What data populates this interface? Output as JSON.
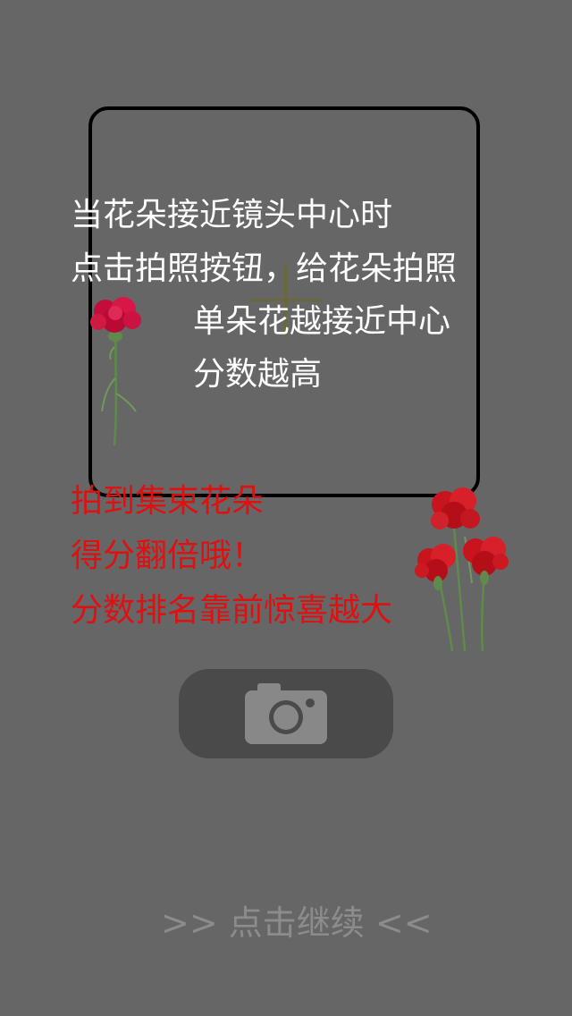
{
  "instructions": {
    "line1": "当花朵接近镜头中心时",
    "line2": "点击拍照按钮，给花朵拍照",
    "line3": "单朵花越接近中心",
    "line4": "分数越高"
  },
  "bonus": {
    "line1": "拍到集束花朵",
    "line2": "得分翻倍哦！",
    "line3": "分数排名靠前惊喜越大"
  },
  "continue": {
    "left_arrows": ">>",
    "label": "点击继续",
    "right_arrows": "<<"
  },
  "colors": {
    "background": "#666666",
    "instruction_text": "#ffffff",
    "bonus_text": "#e01010",
    "continue_text": "#8c8c8c",
    "shutter_button": "#4a4a4a"
  },
  "icons": {
    "shutter": "camera-icon",
    "single_flower": "carnation-icon",
    "bouquet": "carnation-bouquet-icon",
    "crosshair": "crosshair-icon"
  }
}
